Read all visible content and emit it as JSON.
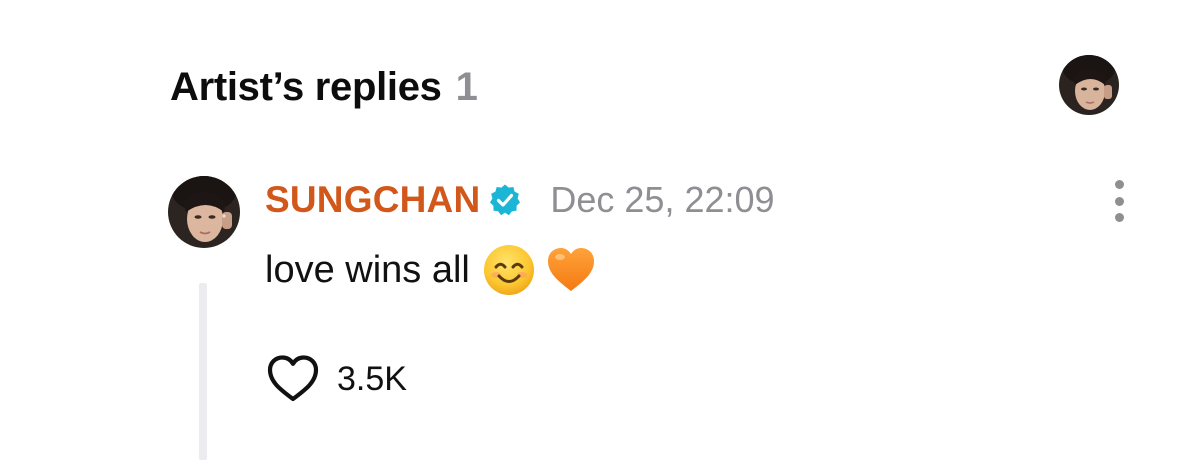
{
  "header": {
    "title": "Artist’s replies",
    "count": "1"
  },
  "reply": {
    "author": "SUNGCHAN",
    "verified": true,
    "timestamp": "Dec 25, 22:09",
    "text": "love wins all",
    "emojis": [
      "smiling-face-with-smiling-eyes",
      "orange-heart"
    ],
    "likes": "3.5K"
  },
  "colors": {
    "author": "#d1571a",
    "verified_badge": "#1bb5d6",
    "muted": "#8e8e93",
    "thread_line": "#ececf0"
  },
  "icons": {
    "header_avatar": "avatar-photo",
    "more": "more-vertical-icon",
    "like": "heart-outline-icon"
  }
}
